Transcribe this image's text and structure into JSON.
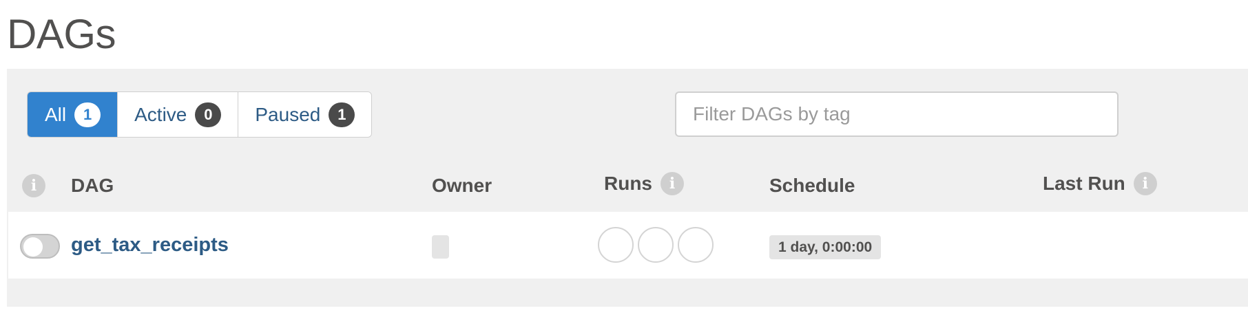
{
  "page": {
    "title": "DAGs"
  },
  "status_filter": {
    "all": {
      "label": "All",
      "count": "1"
    },
    "active": {
      "label": "Active",
      "count": "0"
    },
    "paused": {
      "label": "Paused",
      "count": "1"
    }
  },
  "tag_filter": {
    "placeholder": "Filter DAGs by tag",
    "value": ""
  },
  "table": {
    "headers": {
      "dag": "DAG",
      "owner": "Owner",
      "runs": "Runs",
      "schedule": "Schedule",
      "last_run": "Last Run"
    },
    "rows": [
      {
        "dag_id": "get_tax_receipts",
        "paused": true,
        "owner": "",
        "schedule": "1 day, 0:00:00"
      }
    ]
  },
  "icons": {
    "info": "info-icon",
    "toggle": "toggle-switch"
  },
  "colors": {
    "accent": "#3182ce",
    "link": "#2d5b85",
    "panel_bg": "#f0f0f0",
    "badge_dark": "#4a4a4a"
  }
}
